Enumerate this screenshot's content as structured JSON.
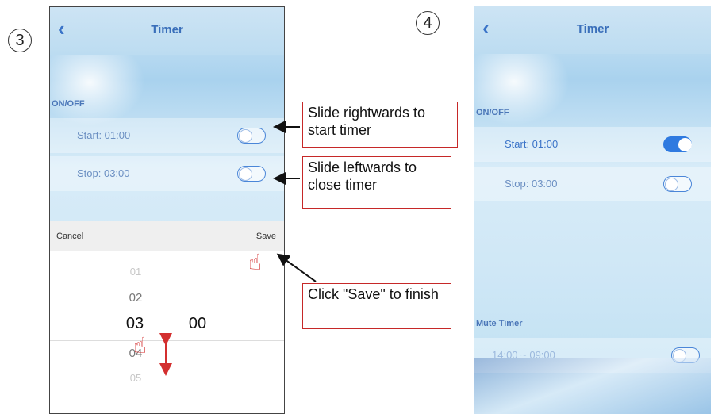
{
  "steps": {
    "left": "3",
    "right": "4"
  },
  "phone1": {
    "title": "Timer",
    "section": "ON/OFF",
    "start_label": "Start: 01:00",
    "stop_label": "Stop: 03:00",
    "start_on": false,
    "stop_on": false,
    "picker": {
      "cancel": "Cancel",
      "save": "Save",
      "hours": [
        "01",
        "02",
        "03",
        "04",
        "05"
      ],
      "minutes_selected": "00"
    }
  },
  "phone2": {
    "title": "Timer",
    "section": "ON/OFF",
    "start_label": "Start: 01:00",
    "stop_label": "Stop: 03:00",
    "start_on": true,
    "stop_on": false,
    "mute_section": "Mute Timer",
    "mute_label": "14:00 ~ 09:00",
    "mute_on": false
  },
  "callouts": {
    "start": "Slide rightwards to start timer",
    "stop": "Slide leftwards to close timer",
    "save": "Click \"Save\" to finish"
  },
  "colors": {
    "accent": "#3a73c8",
    "callout_border": "#c62828",
    "toggle_on": "#2f7ae0"
  },
  "icons": [
    "back-chevron-icon",
    "pointing-hand-icon",
    "up-down-arrow-icon"
  ]
}
